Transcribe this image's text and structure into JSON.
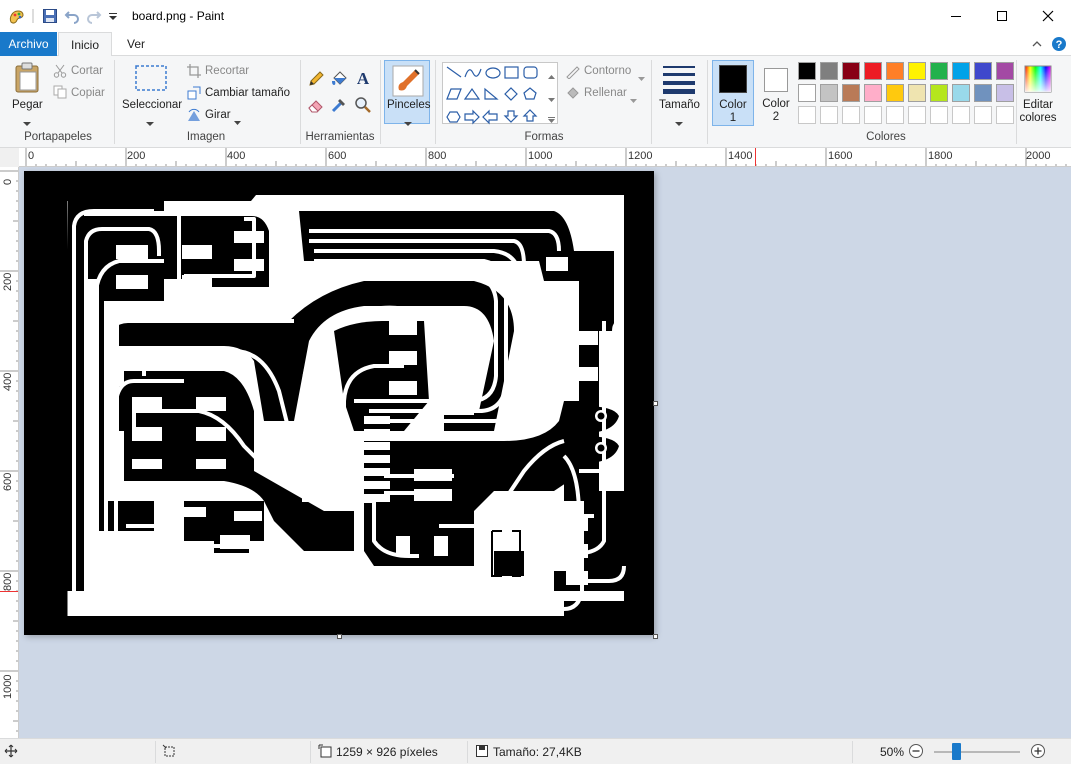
{
  "window": {
    "title": "board.png - Paint"
  },
  "tabs": [
    {
      "label": "Archivo"
    },
    {
      "label": "Inicio"
    },
    {
      "label": "Ver"
    }
  ],
  "ribbon": {
    "portapapeles": {
      "label": "Portapapeles",
      "pegar": "Pegar",
      "cortar": "Cortar",
      "copiar": "Copiar"
    },
    "imagen": {
      "label": "Imagen",
      "seleccionar": "Seleccionar",
      "recortar": "Recortar",
      "cambiar_tamano": "Cambiar tamaño",
      "girar": "Girar"
    },
    "herramientas": {
      "label": "Herramientas"
    },
    "pinceles": "Pinceles",
    "formas": {
      "label": "Formas",
      "contorno": "Contorno",
      "rellenar": "Rellenar"
    },
    "tamano": "Tamaño",
    "color1": {
      "label": "Color",
      "num": "1",
      "color": "#000000"
    },
    "color2": {
      "label": "Color",
      "num": "2",
      "color": "#ffffff"
    },
    "colores": {
      "label": "Colores",
      "editar": "Editar",
      "editar2": "colores",
      "row1": [
        "#000000",
        "#7f7f7f",
        "#880015",
        "#ed1c24",
        "#ff7f27",
        "#fff200",
        "#22b14c",
        "#00a2e8",
        "#3f48cc",
        "#a349a4"
      ],
      "row2": [
        "#ffffff",
        "#c3c3c3",
        "#b97a57",
        "#ffaec9",
        "#ffc90e",
        "#efe4b0",
        "#b5e61d",
        "#99d9ea",
        "#7092be",
        "#c8bfe7"
      ]
    }
  },
  "ruler": {
    "top": [
      "0",
      "200",
      "400",
      "600",
      "800",
      "1000",
      "1200",
      "1400",
      "1600",
      "1800",
      "2000"
    ],
    "left": [
      "0",
      "200",
      "400",
      "600",
      "800",
      "1000"
    ]
  },
  "status": {
    "dimensions": "1259 × 926 píxeles",
    "size": "Tamaño: 27,4KB",
    "zoom": "50%"
  }
}
